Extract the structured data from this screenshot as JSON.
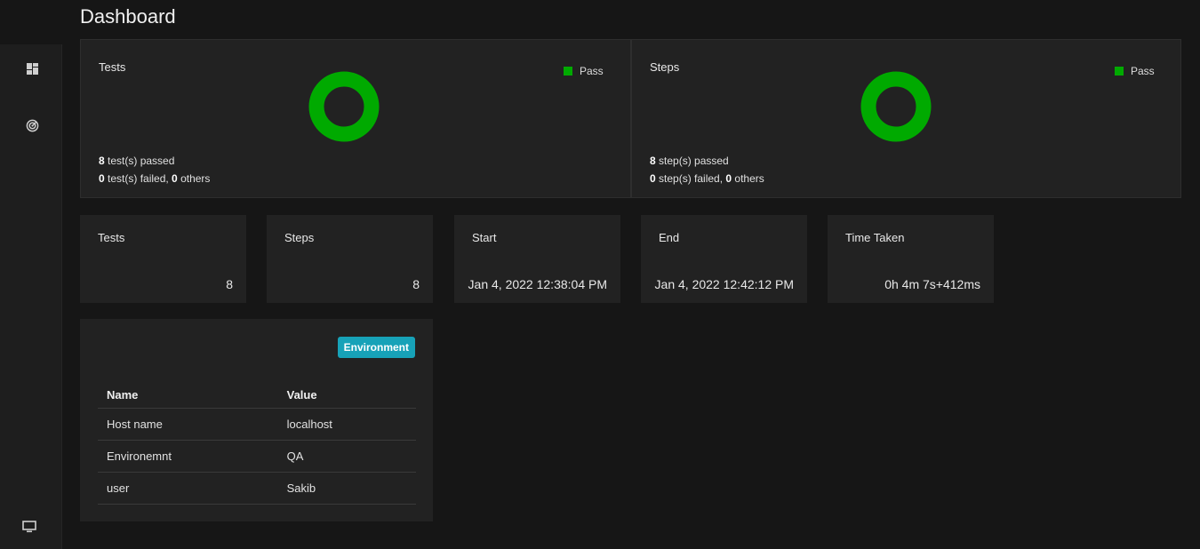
{
  "page": {
    "title": "Dashboard"
  },
  "sidebar": {
    "items": [
      {
        "icon": "dashboard-icon"
      },
      {
        "icon": "radar-icon"
      },
      {
        "icon": "monitor-icon"
      }
    ]
  },
  "colors": {
    "pass": "#00aa00",
    "badge": "#17a2b8"
  },
  "tests_chart": {
    "title": "Tests",
    "legend": "Pass",
    "passed_count": "8",
    "passed_text": " test(s) passed",
    "failed_count": "0",
    "failed_text": " test(s) failed, ",
    "others_count": "0",
    "others_text": " others",
    "pass_fraction": 1.0
  },
  "steps_chart": {
    "title": "Steps",
    "legend": "Pass",
    "passed_count": "8",
    "passed_text": " step(s) passed",
    "failed_count": "0",
    "failed_text": " step(s) failed, ",
    "others_count": "0",
    "others_text": " others",
    "pass_fraction": 1.0
  },
  "stats": [
    {
      "label": "Tests",
      "value": "8"
    },
    {
      "label": "Steps",
      "value": "8"
    },
    {
      "label": "Start",
      "value": "Jan 4, 2022 12:38:04 PM"
    },
    {
      "label": "End",
      "value": "Jan 4, 2022 12:42:12 PM"
    },
    {
      "label": "Time Taken",
      "value": "0h 4m 7s+412ms"
    }
  ],
  "environment": {
    "badge": "Environment",
    "headers": [
      "Name",
      "Value"
    ],
    "rows": [
      [
        "Host name",
        "localhost"
      ],
      [
        "Environemnt",
        "QA"
      ],
      [
        "user",
        "Sakib"
      ]
    ]
  }
}
